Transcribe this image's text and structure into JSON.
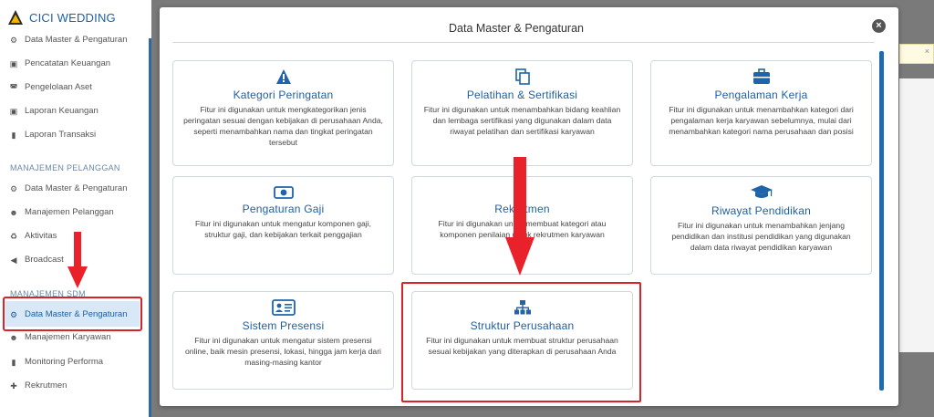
{
  "brand": {
    "name": "CICI WEDDING"
  },
  "sidebar": {
    "items_top": [
      {
        "label": "Data Master & Pengaturan",
        "icon": "gears-icon"
      },
      {
        "label": "Pencatatan Keuangan",
        "icon": "money-icon"
      },
      {
        "label": "Pengelolaan Aset",
        "icon": "car-icon"
      },
      {
        "label": "Laporan Keuangan",
        "icon": "money-icon"
      },
      {
        "label": "Laporan Transaksi",
        "icon": "book-icon"
      }
    ],
    "section_pelanggan": "MANAJEMEN PELANGGAN",
    "items_pelanggan": [
      {
        "label": "Data Master & Pengaturan",
        "icon": "gears-icon"
      },
      {
        "label": "Manajemen Pelanggan",
        "icon": "users-icon"
      },
      {
        "label": "Aktivitas",
        "icon": "recycle-icon"
      },
      {
        "label": "Broadcast",
        "icon": "bullhorn-icon"
      }
    ],
    "section_sdm": "MANAJEMEN SDM",
    "items_sdm": [
      {
        "label": "Data Master & Pengaturan",
        "icon": "gears-icon",
        "active": true
      },
      {
        "label": "Manajemen Karyawan",
        "icon": "users-icon"
      },
      {
        "label": "Monitoring Performa",
        "icon": "book-icon"
      },
      {
        "label": "Rekrutmen",
        "icon": "user-plus-icon"
      }
    ]
  },
  "modal": {
    "title": "Data Master & Pengaturan",
    "close_label": "×",
    "cards": [
      {
        "title": "Kategori Peringatan",
        "icon": "warning-icon",
        "desc": "Fitur ini digunakan untuk mengkategorikan jenis peringatan sesuai dengan kebijakan di perusahaan Anda, seperti menambahkan nama dan tingkat peringatan tersebut"
      },
      {
        "title": "Pelatihan & Sertifikasi",
        "icon": "copy-icon",
        "desc": "Fitur ini digunakan untuk menambahkan bidang keahlian dan lembaga sertifikasi yang digunakan dalam data riwayat pelatihan dan sertifikasi karyawan"
      },
      {
        "title": "Pengalaman Kerja",
        "icon": "briefcase-icon",
        "desc": "Fitur ini digunakan untuk menambahkan kategori dari pengalaman kerja karyawan sebelumnya, mulai dari menambahkan kategori nama perusahaan dan posisi"
      },
      {
        "title": "Pengaturan Gaji",
        "icon": "money-icon",
        "desc": "Fitur ini digunakan untuk mengatur komponen gaji, struktur gaji, dan kebijakan terkait penggajian"
      },
      {
        "title": "Rekrutmen",
        "icon": "",
        "desc": "Fitur ini digunakan untuk membuat kategori atau komponen penilaian untuk rekrutmen karyawan"
      },
      {
        "title": "Riwayat Pendidikan",
        "icon": "graduation-cap-icon",
        "desc": "Fitur ini digunakan untuk menambahkan jenjang pendidikan dan institusi pendidikan yang digunakan dalam data riwayat pendidikan karyawan"
      },
      {
        "title": "Sistem Presensi",
        "icon": "id-card-icon",
        "desc": "Fitur ini digunakan untuk mengatur sistem presensi online, baik mesin presensi, lokasi, hingga jam kerja dari masing-masing kantor"
      },
      {
        "title": "Struktur Perusahaan",
        "icon": "sitemap-icon",
        "desc": "Fitur ini digunakan untuk membuat struktur perusahaan sesuai kebijakan yang diterapkan di perusahaan Anda"
      }
    ]
  },
  "colors": {
    "primary": "#1f5fa0",
    "annotation_red": "#d9232a",
    "active_bg": "#d9e8f6"
  }
}
